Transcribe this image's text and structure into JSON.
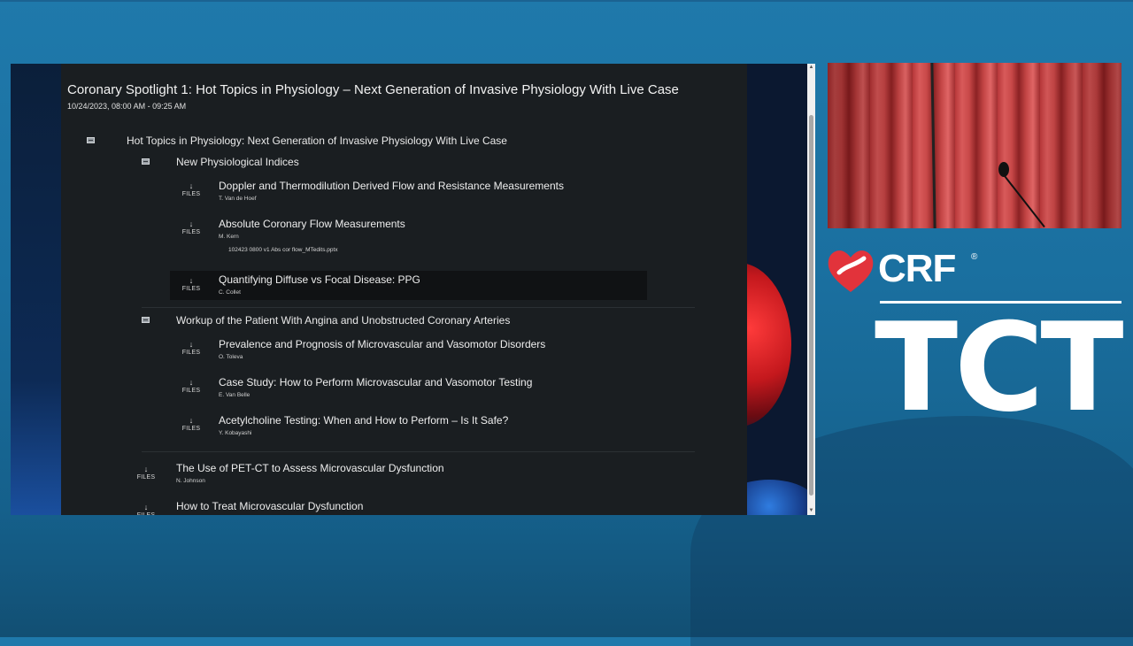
{
  "session": {
    "title": "Coronary Spotlight 1: Hot Topics in Physiology – Next Generation of Invasive Physiology With Live Case",
    "datetime": "10/24/2023, 08:00 AM - 09:25 AM"
  },
  "files_label": "FILES",
  "download_glyph": "↓",
  "outline": {
    "top": {
      "title": "Hot Topics in Physiology: Next Generation of Invasive Physiology With Live Case"
    },
    "group1": {
      "title": "New Physiological Indices",
      "talks": [
        {
          "title": "Doppler and Thermodilution Derived Flow and Resistance Measurements",
          "speaker": "T. Van de Hoef"
        },
        {
          "title": "Absolute Coronary Flow Measurements",
          "speaker": "M. Kern",
          "file": "102423 0800 v1 Abs cor flow_MTedits.pptx"
        },
        {
          "title": "Quantifying Diffuse vs Focal Disease: PPG",
          "speaker": "C. Collet"
        }
      ]
    },
    "group2": {
      "title": "Workup of the Patient With Angina and Unobstructed Coronary Arteries",
      "talks": [
        {
          "title": "Prevalence and Prognosis of Microvascular and Vasomotor Disorders",
          "speaker": "O. Toleva"
        },
        {
          "title": "Case Study: How to Perform Microvascular and Vasomotor Testing",
          "speaker": "E. Van Belle"
        },
        {
          "title": "Acetylcholine Testing: When and How to Perform – Is It Safe?",
          "speaker": "Y. Kobayashi"
        }
      ]
    },
    "standalone": [
      {
        "title": "The Use of PET-CT to Assess Microvascular Dysfunction",
        "speaker": "N. Johnson"
      },
      {
        "title": "How to Treat Microvascular Dysfunction"
      }
    ]
  },
  "branding": {
    "crf": "CRF",
    "registered": "®",
    "tct": "TCT",
    "heart_color": "#e2333b"
  }
}
